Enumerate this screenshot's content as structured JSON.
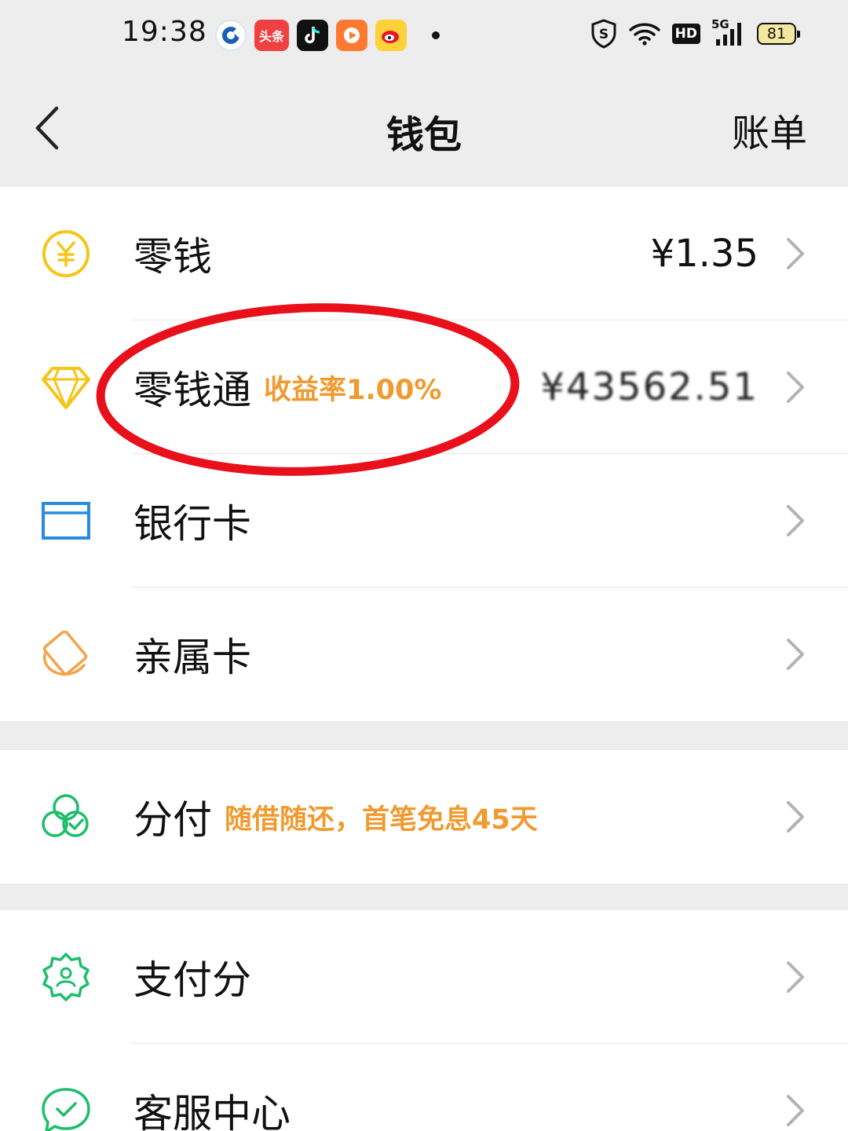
{
  "status_bar": {
    "time": "19:38",
    "notifications": [
      {
        "name": "ccb-app-icon",
        "text": ""
      },
      {
        "name": "toutiao-app-icon",
        "text": "头条"
      },
      {
        "name": "douyin-app-icon",
        "text": ""
      },
      {
        "name": "video-app-icon",
        "text": ""
      },
      {
        "name": "weibo-app-icon",
        "text": ""
      }
    ],
    "hd_label": "HD",
    "network_label": "5G",
    "battery_level": "81"
  },
  "header": {
    "title": "钱包",
    "right_link": "账单"
  },
  "sections": [
    {
      "rows": [
        {
          "label": "零钱",
          "tag": "",
          "value": "¥1.35"
        },
        {
          "label": "零钱通",
          "tag": "收益率1.00%",
          "value": "¥43562.51"
        },
        {
          "label": "银行卡",
          "tag": "",
          "value": ""
        },
        {
          "label": "亲属卡",
          "tag": "",
          "value": ""
        }
      ]
    },
    {
      "rows": [
        {
          "label": "分付",
          "tag": "随借随还，首笔免息45天",
          "value": ""
        }
      ]
    },
    {
      "rows": [
        {
          "label": "支付分",
          "tag": "",
          "value": ""
        },
        {
          "label": "客服中心",
          "tag": "",
          "value": ""
        }
      ]
    }
  ],
  "colors": {
    "background": "#ededed",
    "row_background": "#ffffff",
    "tag_orange": "#f09a2f",
    "coin_yellow": "#f5c518",
    "card_blue": "#2a8ae0",
    "family_orange": "#f5a34a",
    "wechat_green": "#1dbe6b",
    "annotation_red": "#e8101b"
  },
  "icons": {
    "back": "chevron-left-icon",
    "change": "yuan-coin-icon",
    "lingqiantong": "diamond-icon",
    "bank_card": "bank-card-icon",
    "family_card": "family-card-icon",
    "fenfu": "fenfu-circles-icon",
    "payscore": "payscore-badge-icon",
    "service": "customer-service-icon",
    "row_arrow": "chevron-right-icon"
  }
}
